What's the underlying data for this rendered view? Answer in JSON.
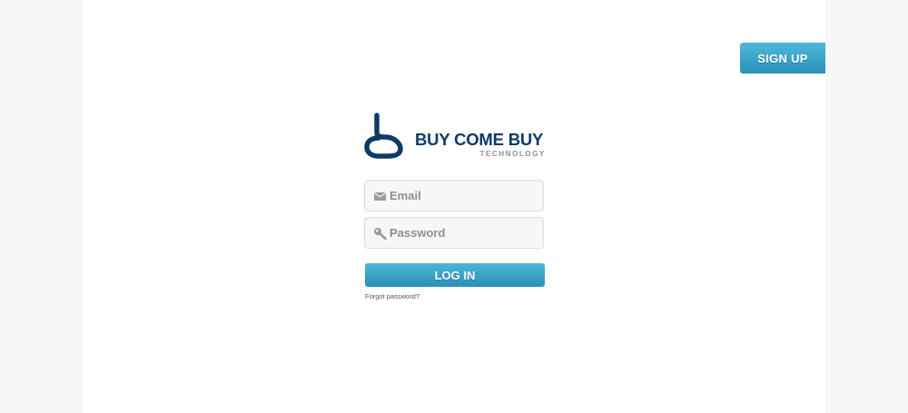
{
  "header": {
    "signup_label": "SIGN UP"
  },
  "logo": {
    "brand": "BUY COME BUY",
    "tagline": "TECHNOLOGY",
    "icon": "bcb-logo-mark",
    "color": "#0e3a66"
  },
  "login_form": {
    "email_placeholder": "Email",
    "email_icon": "envelope-icon",
    "password_placeholder": "Password",
    "password_icon": "key-icon",
    "login_label": "LOG IN",
    "forgot_label": "Forgot password?"
  },
  "colors": {
    "accent": "#2f9fc6",
    "background": "#f7f7f7",
    "panel": "#ffffff"
  }
}
